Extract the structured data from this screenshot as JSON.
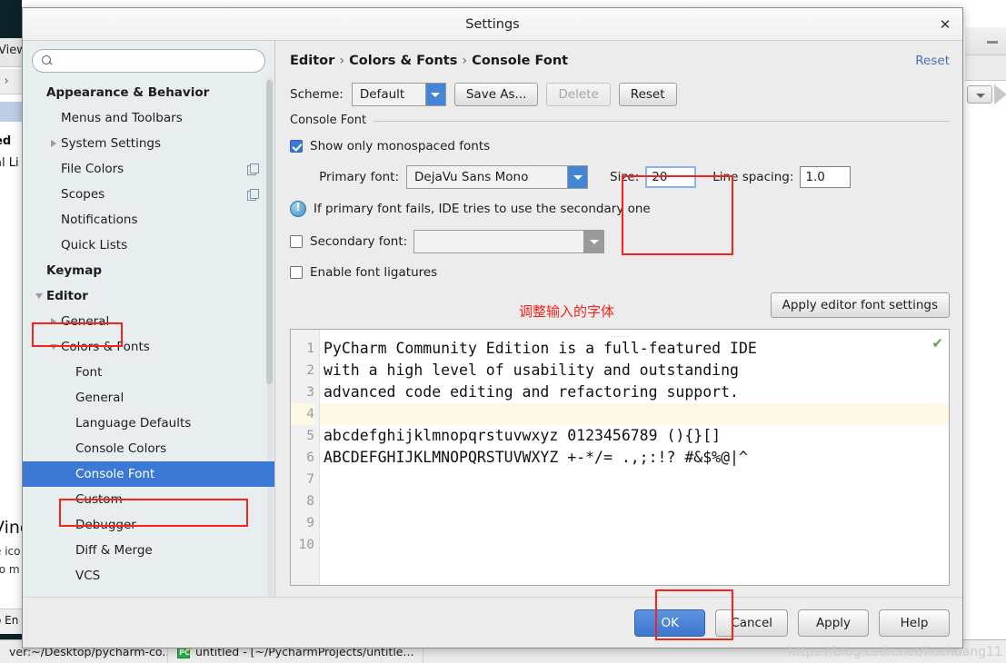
{
  "background": {
    "menu_fragment": "View",
    "breadcrumb_fragment": "| ›",
    "text_fragment_1": "ed",
    "text_fragment_2": "al Li",
    "window_title_fragment": "Vinc",
    "window_line_1": "e ico",
    "window_line_2": "to m",
    "enter_fragment": "o En",
    "taskbar": [
      "ver:~/Desktop/pycharm-co...",
      "untitled - [~/PycharmProjects/untitle..."
    ]
  },
  "dialog": {
    "title": "Settings",
    "close_icon": "✕"
  },
  "search": {
    "value": "",
    "placeholder": ""
  },
  "tree": [
    {
      "label": "Appearance & Behavior",
      "level": 0,
      "group": true,
      "twist": "",
      "selected": false,
      "copy": false
    },
    {
      "label": "Menus and Toolbars",
      "level": 1,
      "group": false,
      "twist": "",
      "selected": false,
      "copy": false
    },
    {
      "label": "System Settings",
      "level": 1,
      "group": false,
      "twist": "right",
      "selected": false,
      "copy": false
    },
    {
      "label": "File Colors",
      "level": 1,
      "group": false,
      "twist": "",
      "selected": false,
      "copy": true
    },
    {
      "label": "Scopes",
      "level": 1,
      "group": false,
      "twist": "",
      "selected": false,
      "copy": true
    },
    {
      "label": "Notifications",
      "level": 1,
      "group": false,
      "twist": "",
      "selected": false,
      "copy": false
    },
    {
      "label": "Quick Lists",
      "level": 1,
      "group": false,
      "twist": "",
      "selected": false,
      "copy": false
    },
    {
      "label": "Keymap",
      "level": 0,
      "group": true,
      "twist": "",
      "selected": false,
      "copy": false
    },
    {
      "label": "Editor",
      "level": 0,
      "group": true,
      "twist": "down",
      "selected": false,
      "copy": false
    },
    {
      "label": "General",
      "level": 1,
      "group": false,
      "twist": "right",
      "selected": false,
      "copy": false
    },
    {
      "label": "Colors & Fonts",
      "level": 1,
      "group": false,
      "twist": "down",
      "selected": false,
      "copy": false
    },
    {
      "label": "Font",
      "level": 2,
      "group": false,
      "twist": "",
      "selected": false,
      "copy": false
    },
    {
      "label": "General",
      "level": 2,
      "group": false,
      "twist": "",
      "selected": false,
      "copy": false
    },
    {
      "label": "Language Defaults",
      "level": 2,
      "group": false,
      "twist": "",
      "selected": false,
      "copy": false
    },
    {
      "label": "Console Colors",
      "level": 2,
      "group": false,
      "twist": "",
      "selected": false,
      "copy": false
    },
    {
      "label": "Console Font",
      "level": 2,
      "group": false,
      "twist": "",
      "selected": true,
      "copy": false
    },
    {
      "label": "Custom",
      "level": 2,
      "group": false,
      "twist": "",
      "selected": false,
      "copy": false
    },
    {
      "label": "Debugger",
      "level": 2,
      "group": false,
      "twist": "",
      "selected": false,
      "copy": false
    },
    {
      "label": "Diff & Merge",
      "level": 2,
      "group": false,
      "twist": "",
      "selected": false,
      "copy": false
    },
    {
      "label": "VCS",
      "level": 2,
      "group": false,
      "twist": "",
      "selected": false,
      "copy": false
    }
  ],
  "content": {
    "breadcrumb": [
      "Editor",
      "Colors & Fonts",
      "Console Font"
    ],
    "breadcrumb_sep": "›",
    "reset_link": "Reset",
    "scheme_label": "Scheme:",
    "scheme_value": "Default",
    "save_as_label": "Save As...",
    "delete_label": "Delete",
    "reset_label": "Reset",
    "group_title": "Console Font",
    "show_only_monospaced_label": "Show only monospaced fonts",
    "show_only_monospaced_checked": true,
    "primary_font_label": "Primary font:",
    "primary_font_value": "DejaVu Sans Mono",
    "size_label": "Size:",
    "size_value": "20",
    "line_spacing_label": "Line spacing:",
    "line_spacing_value": "1.0",
    "info_text": "If primary font fails, IDE tries to use the secondary one",
    "secondary_font_label": "Secondary font:",
    "secondary_font_value": "",
    "secondary_font_checked": false,
    "ligatures_label": "Enable font ligatures",
    "ligatures_checked": false,
    "annotation_cn": "调整输入的字体",
    "apply_editor_font_label": "Apply editor font settings"
  },
  "preview": {
    "gutter": [
      "1",
      "2",
      "3",
      "4",
      "5",
      "6",
      "7",
      "8",
      "9",
      "10"
    ],
    "lines": [
      "PyCharm Community Edition is a full-featured IDE",
      "with a high level of usability and outstanding",
      "advanced code editing and refactoring support.",
      "",
      "abcdefghijklmnopqrstuvwxyz 0123456789 (){}[]",
      "ABCDEFGHIJKLMNOPQRSTUVWXYZ +-*/= .,;:!? #&$%@|^",
      "",
      "",
      "",
      ""
    ],
    "caret_line": 4,
    "check_icon": "✔",
    "drag_handle": "......"
  },
  "footer": {
    "ok_label": "OK",
    "cancel_label": "Cancel",
    "apply_label": "Apply",
    "help_label": "Help"
  },
  "watermark": "https://blog.csdn.net/liuchuang11",
  "colors": {
    "accent": "#3b79d4",
    "annotation_red": "#f5231b",
    "link": "#4a6fb5",
    "caret_row": "#fdf9e6"
  }
}
